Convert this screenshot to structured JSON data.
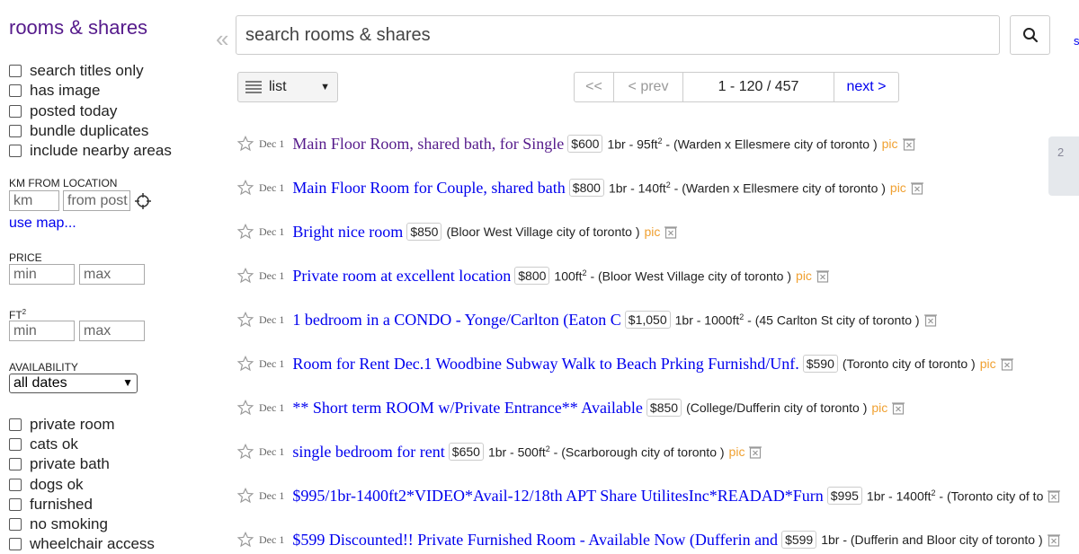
{
  "sidebar": {
    "category_title": "rooms & shares",
    "filters_top": [
      "search titles only",
      "has image",
      "posted today",
      "bundle duplicates",
      "include nearby areas"
    ],
    "km_label": "KM FROM LOCATION",
    "km_placeholder": "km",
    "from_placeholder": "from post",
    "use_map": "use map...",
    "price_label": "PRICE",
    "min_placeholder": "min",
    "max_placeholder": "max",
    "ft_label": "FT",
    "ft_sup": "2",
    "availability_label": "AVAILABILITY",
    "availability_value": "all dates",
    "filters_bottom": [
      "private room",
      "cats ok",
      "private bath",
      "dogs ok",
      "furnished",
      "no smoking",
      "wheelchair access"
    ]
  },
  "search": {
    "placeholder": "search rooms & shares",
    "collapse_glyph": "«",
    "edge_link": "s"
  },
  "toolbar": {
    "view_mode": "list",
    "pager_first": "<<",
    "pager_prev": "< prev",
    "pager_range": "1 - 120 / 457",
    "pager_next": "next >"
  },
  "listings": [
    {
      "date": "Dec 1",
      "title": "Main Floor Room, shared bath, for Single",
      "price": "$600",
      "meta": "1br - 95ft",
      "sup": "2",
      "meta2": " - (Warden x Ellesmere city of toronto )",
      "pic": "pic",
      "visited": true
    },
    {
      "date": "Dec 1",
      "title": "Main Floor Room for Couple, shared bath",
      "price": "$800",
      "meta": "1br - 140ft",
      "sup": "2",
      "meta2": " - (Warden x Ellesmere city of toronto )",
      "pic": "pic",
      "visited": false
    },
    {
      "date": "Dec 1",
      "title": "Bright nice room",
      "price": "$850",
      "meta": "(Bloor West Village city of toronto )",
      "sup": "",
      "meta2": "",
      "pic": "pic",
      "visited": false
    },
    {
      "date": "Dec 1",
      "title": "Private room at excellent location",
      "price": "$800",
      "meta": "100ft",
      "sup": "2",
      "meta2": " - (Bloor West Village city of toronto )",
      "pic": "pic",
      "visited": false
    },
    {
      "date": "Dec 1",
      "title": "1 bedroom in a CONDO - Yonge/Carlton (Eaton C",
      "price": "$1,050",
      "meta": "1br - 1000ft",
      "sup": "2",
      "meta2": " - (45 Carlton St city of toronto )",
      "pic": "",
      "visited": false
    },
    {
      "date": "Dec 1",
      "title": "Room for Rent Dec.1 Woodbine Subway Walk to Beach Prking Furnishd/Unf.",
      "price": "$590",
      "meta": "(Toronto city of toronto )",
      "sup": "",
      "meta2": "",
      "pic": "pic",
      "visited": false
    },
    {
      "date": "Dec 1",
      "title": "** Short term ROOM w/Private Entrance** Available",
      "price": "$850",
      "meta": "(College/Dufferin city of toronto )",
      "sup": "",
      "meta2": "",
      "pic": "pic",
      "visited": false
    },
    {
      "date": "Dec 1",
      "title": "single bedroom for rent",
      "price": "$650",
      "meta": "1br - 500ft",
      "sup": "2",
      "meta2": " - (Scarborough city of toronto )",
      "pic": "pic",
      "visited": false
    },
    {
      "date": "Dec 1",
      "title": "$995/1br-1400ft2*VIDEO*Avail-12/18th APT Share UtilitesInc*READAD*Furn",
      "price": "$995",
      "meta": "1br - 1400ft",
      "sup": "2",
      "meta2": " - (Toronto city of to",
      "pic": "",
      "visited": false
    },
    {
      "date": "Dec 1",
      "title": "$599 Discounted!! Private Furnished Room - Available Now (Dufferin and",
      "price": "$599",
      "meta": "1br - (Dufferin and Bloor city of toronto )",
      "sup": "",
      "meta2": "",
      "pic": "",
      "visited": false
    }
  ],
  "map_thumb_label": "2",
  "colors": {
    "link": "#0000ee",
    "visited": "#551a8b",
    "pic": "#f0a030"
  }
}
